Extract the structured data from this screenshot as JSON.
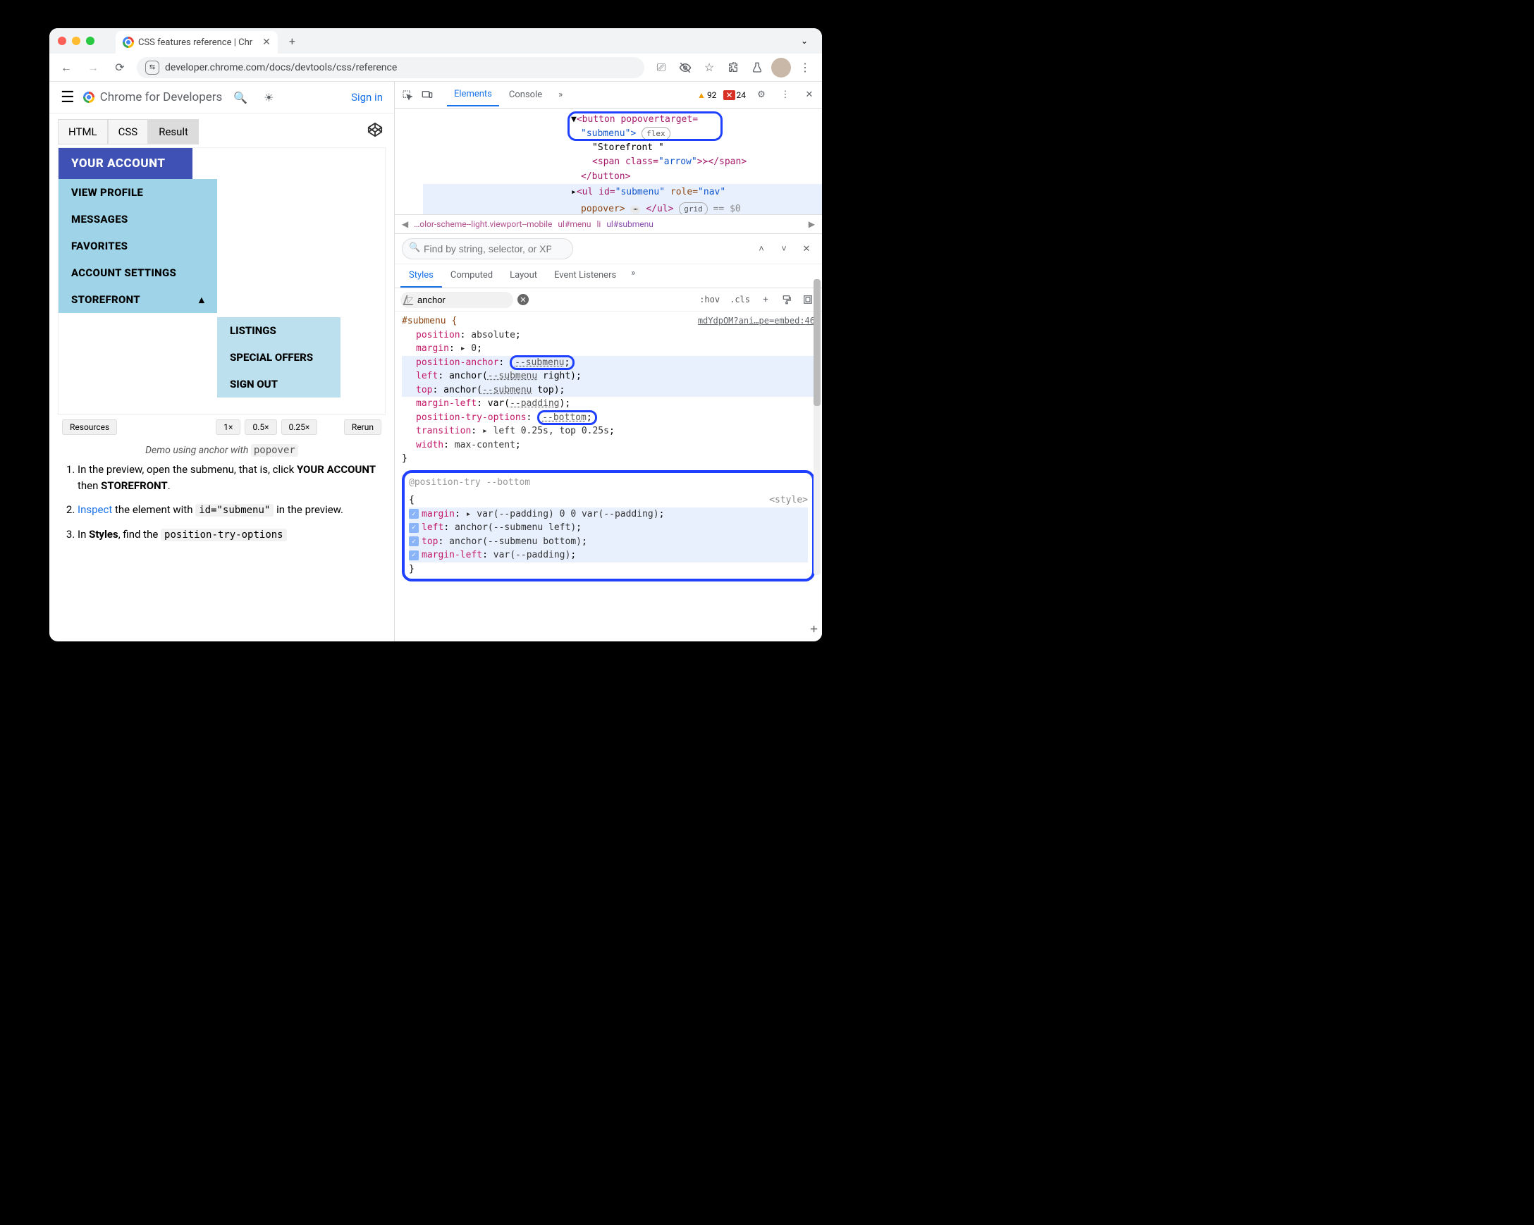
{
  "tab": {
    "title": "CSS features reference  |  Chr"
  },
  "url": "developer.chrome.com/docs/devtools/css/reference",
  "page_header": {
    "brand": "Chrome for Developers",
    "signin": "Sign in"
  },
  "demo": {
    "tabs": {
      "html": "HTML",
      "css": "CSS",
      "result": "Result"
    },
    "account_header": "YOUR ACCOUNT",
    "items": [
      "VIEW PROFILE",
      "MESSAGES",
      "FAVORITES",
      "ACCOUNT SETTINGS",
      "STOREFRONT"
    ],
    "flyout": [
      "LISTINGS",
      "SPECIAL OFFERS",
      "SIGN OUT"
    ],
    "footer": {
      "resources": "Resources",
      "z1": "1×",
      "z05": "0.5×",
      "z025": "0.25×",
      "rerun": "Rerun"
    },
    "caption_pre": "Demo using anchor with ",
    "caption_code": "popover"
  },
  "steps": {
    "s1a": "In the preview, open the submenu, that is, click ",
    "s1b": "YOUR ACCOUNT",
    "s1c": " then ",
    "s1d": "STOREFRONT",
    "s1e": ".",
    "s2a": "Inspect",
    "s2b": " the element with ",
    "s2code": "id=\"submenu\"",
    "s2c": " in the preview.",
    "s3a": "In ",
    "s3b": "Styles",
    "s3c": ", find the ",
    "s3code": "position-try-options"
  },
  "devtools": {
    "tabs": {
      "elements": "Elements",
      "console": "Console"
    },
    "warn_count": "92",
    "err_count": "24",
    "dom": {
      "l1": "<button popovertarget=",
      "l1b": "\"submenu\">",
      "flex": "flex",
      "l2": "\"Storefront \"",
      "l3a": "<span class=",
      "l3b": "\"arrow\"",
      "l3c": ">≻</span>",
      "l4": "</button>",
      "l5a": "<ul id=",
      "l5b": "\"submenu\"",
      "l5c": " role=",
      "l5d": "\"nav\"",
      "l5e": " popover>",
      "dots": "⋯",
      "l5f": "</ul>",
      "grid": "grid",
      "eq0": " == $0"
    },
    "crumb": {
      "a": "…olor-scheme--light.viewport--mobile",
      "b": "ul#menu",
      "c": "li",
      "d": "ul#submenu"
    },
    "find_placeholder": "Find by string, selector, or XPath",
    "styles_tabs": {
      "styles": "Styles",
      "computed": "Computed",
      "layout": "Layout",
      "listeners": "Event Listeners"
    },
    "filter_value": "anchor",
    "hov": ":hov",
    "cls": ".cls",
    "rule": {
      "selector": "#submenu {",
      "source": "mdYdpOM?ani…pe=embed:46",
      "p1": "position",
      "v1": "absolute",
      "p2": "margin",
      "v2": "▸ 0",
      "p3": "position-anchor",
      "v3": "--submenu",
      "p4": "left",
      "v4a": "anchor(",
      "v4var": "--submenu",
      "v4b": " right)",
      "p5": "top",
      "v5a": "anchor(",
      "v5var": "--submenu",
      "v5b": " top)",
      "p6": "margin-left",
      "v6a": "var(",
      "v6var": "--padding",
      "v6b": ")",
      "p7": "position-try-options",
      "v7": "--bottom",
      "p8": "transition",
      "v8": "▸ left 0.25s, top 0.25s",
      "p9": "width",
      "v9": "max-content",
      "close": "}"
    },
    "try_rule": {
      "header": "@position-try --bottom",
      "open": "{",
      "style_tag": "<style>",
      "r1p": "margin",
      "r1v": "▸ var(--padding) 0 0 var(--padding)",
      "r2p": "left",
      "r2v": "anchor(--submenu left)",
      "r3p": "top",
      "r3v": "anchor(--submenu bottom)",
      "r4p": "margin-left",
      "r4v": "var(--padding)",
      "close": "}"
    }
  }
}
